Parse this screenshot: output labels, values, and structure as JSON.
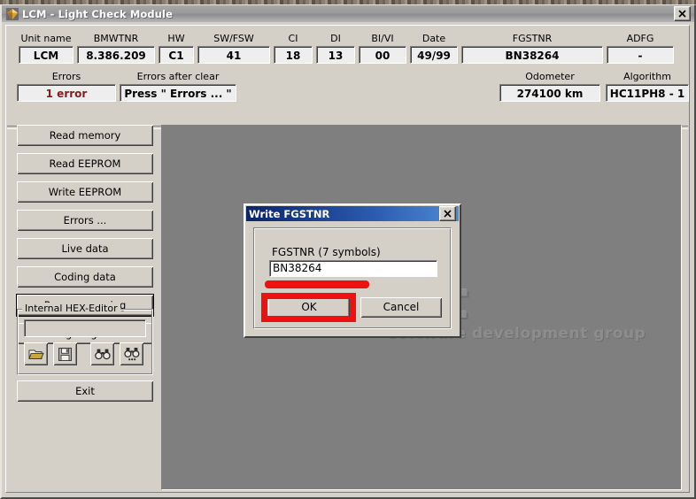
{
  "window": {
    "title": "LCM - Light Check Module",
    "icon": "gem-icon",
    "close_label": "×",
    "close_icon": "close-icon"
  },
  "header": {
    "fields": [
      {
        "label": "Unit name",
        "value": "LCM"
      },
      {
        "label": "BMWTNR",
        "value": "8.386.209"
      },
      {
        "label": "HW",
        "value": "C1"
      },
      {
        "label": "SW/FSW",
        "value": "41"
      },
      {
        "label": "CI",
        "value": "18"
      },
      {
        "label": "DI",
        "value": "13"
      },
      {
        "label": "BI/VI",
        "value": "00"
      },
      {
        "label": "Date",
        "value": "49/99"
      },
      {
        "label": "FGSTNR",
        "value": "BN38264"
      },
      {
        "label": "ADFG",
        "value": "-"
      }
    ],
    "errors": {
      "label": "Errors",
      "value": "1 error",
      "color": "#8b1a1a"
    },
    "errors_after_clear": {
      "label": "Errors after clear",
      "value": "Press \" Errors ... \""
    },
    "odometer": {
      "label": "Odometer",
      "value": "274100 km"
    },
    "algorithm": {
      "label": "Algorithm",
      "value": "HC11PH8 - 1"
    }
  },
  "sidebar": {
    "buttons": [
      {
        "label": "Read memory",
        "focused": false
      },
      {
        "label": "Read EEPROM",
        "focused": false
      },
      {
        "label": "Write EEPROM",
        "focused": false
      },
      {
        "label": "Errors ...",
        "focused": false
      },
      {
        "label": "Live data",
        "focused": false
      },
      {
        "label": "Coding data",
        "focused": false
      },
      {
        "label": "Reprogramming",
        "focused": true
      },
      {
        "label": "Change algorithm",
        "focused": false
      }
    ],
    "exit_label": "Exit"
  },
  "hex_editor": {
    "legend": "Internal HEX-Editor",
    "path_value": "",
    "path_placeholder": "",
    "tools": [
      {
        "name": "open-folder-icon",
        "title": "Open"
      },
      {
        "name": "save-disk-icon",
        "title": "Save"
      },
      {
        "name": "find-icon",
        "title": "Find"
      },
      {
        "name": "find-next-icon",
        "title": "Find next"
      }
    ]
  },
  "content": {
    "watermark_main": "oft",
    "watermark_sub": "software development group"
  },
  "dialog": {
    "title": "Write FGSTNR",
    "close_label": "×",
    "field_label": "FGSTNR (7 symbols)",
    "field_value": "BN38264",
    "ok_label": "OK",
    "cancel_label": "Cancel"
  },
  "annotation": {
    "color": "#ee1111",
    "underline_target": "fgstnr-input",
    "highlight_target": "ok-button"
  }
}
